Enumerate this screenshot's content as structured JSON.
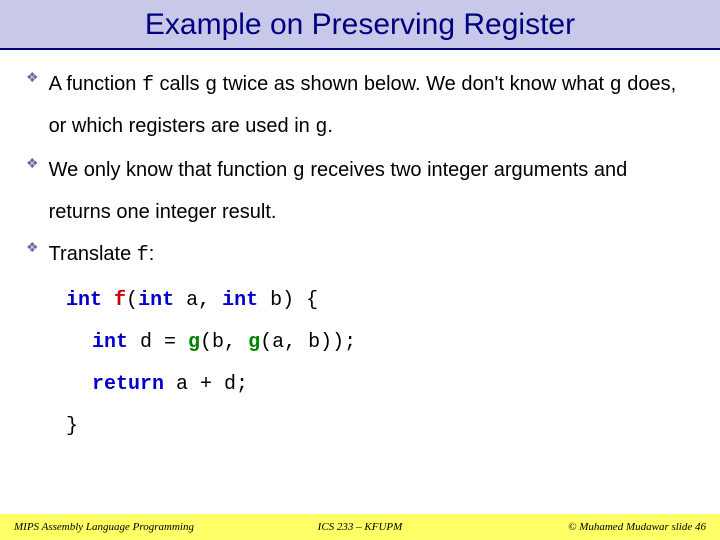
{
  "title": "Example on Preserving Register",
  "bullets": [
    {
      "pre1": "A function ",
      "code1": "f",
      "mid1": " calls ",
      "code2": "g",
      "mid2": " twice as shown below. We don't know what ",
      "code3": "g",
      "mid3": " does, or which registers are used in ",
      "code4": "g",
      "post": "."
    },
    {
      "pre1": "We only know that function ",
      "code1": "g",
      "mid1": " receives two integer arguments and returns one integer result."
    },
    {
      "pre1": "Translate ",
      "code1": "f",
      "mid1": ":"
    }
  ],
  "code": {
    "line1_kw": "int",
    "line1_fn": "f",
    "line1_rest_a": "(",
    "line1_kw2": "int",
    "line1_rest_b": " a, ",
    "line1_kw3": "int",
    "line1_rest_c": " b) {",
    "line2_kw": "int",
    "line2_mid": " d = ",
    "line2_g1": "g",
    "line2_p1": "(b, ",
    "line2_g2": "g",
    "line2_p2": "(a, b));",
    "line3_kw": "return",
    "line3_rest": " a + d;",
    "line4": "}"
  },
  "footer": {
    "left": "MIPS Assembly Language Programming",
    "center": "ICS 233 – KFUPM",
    "right": "© Muhamed Mudawar   slide 46"
  }
}
